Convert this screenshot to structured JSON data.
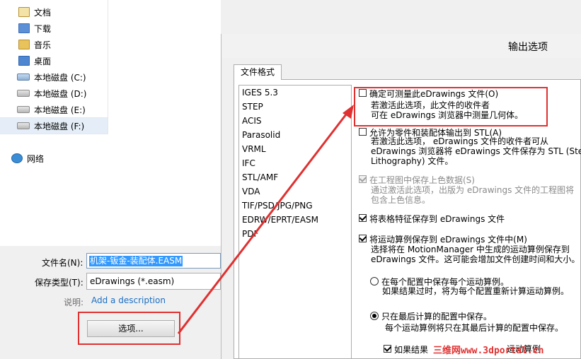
{
  "nav": {
    "items": [
      {
        "label": "文档",
        "icon": "document-folder-icon"
      },
      {
        "label": "下载",
        "icon": "download-folder-icon"
      },
      {
        "label": "音乐",
        "icon": "music-folder-icon"
      },
      {
        "label": "桌面",
        "icon": "desktop-folder-icon"
      },
      {
        "label": "本地磁盘 (C:)",
        "icon": "windows-drive-icon"
      },
      {
        "label": "本地磁盘 (D:)",
        "icon": "drive-icon"
      },
      {
        "label": "本地磁盘 (E:)",
        "icon": "drive-icon"
      },
      {
        "label": "本地磁盘 (F:)",
        "icon": "drive-icon"
      },
      {
        "label": "网络",
        "icon": "network-icon"
      }
    ]
  },
  "save": {
    "filename_label": "文件名(N):",
    "filename_value": "机架-钣金-装配体.EASM",
    "filetype_label": "保存类型(T):",
    "filetype_value": "eDrawings (*.easm)",
    "desc_label": "说明:",
    "desc_link": "Add a description",
    "options_button": "选项..."
  },
  "options_dialog": {
    "title": "输出选项",
    "tab": "文件格式",
    "formats": [
      "IGES 5.3",
      "STEP",
      "ACIS",
      "Parasolid",
      "VRML",
      "IFC",
      "STL/AMF",
      "VDA",
      "TIF/PSD/JPG/PNG",
      "EDRW/EPRT/EASM",
      "PDF"
    ],
    "options": {
      "measurable_label": "确定可测量此eDrawings 文件(O)",
      "measurable_desc1": "若激活此选项，此文件的收件者",
      "measurable_desc2": "可在 eDrawings 浏览器中测量几何体。",
      "stl_label": "允许为零件和装配体输出到 STL(A)",
      "stl_desc1": "若激活此选项， eDrawings 文件的收件者可从",
      "stl_desc2": "eDrawings 浏览器将  eDrawings 文件保存为 STL (Stereo",
      "stl_desc3": "Lithography) 文件。",
      "shade_label": "在工程图中保存上色数据(S)",
      "shade_desc1": "通过激活此选项，出版为  eDrawings 文件的工程图将",
      "shade_desc2": "包含上色信息。",
      "table_label": "将表格特征保存到 eDrawings 文件",
      "motion_label": "将运动算例保存到  eDrawings 文件中(M)",
      "motion_desc1": "选择将在 MotionManager 中生成的运动算例保存到",
      "motion_desc2": "eDrawings 文件。这可能会增加文件创建时间和大小。",
      "radio_each_label": "在每个配置中保存每个运动算例。",
      "radio_each_desc": "如果结果过时，将为每个配置重新计算运动算例。",
      "radio_last_label": "只在最后计算的配置中保存。",
      "radio_last_desc": "每个运动算例将只在其最后计算的配置中保存。",
      "partial_label": "如果结果",
      "partial_label2": "运动算例"
    }
  },
  "watermark": "三维网www.3dportal.cn",
  "colors": {
    "highlight_red": "#e03030",
    "selection_blue": "#3399ff",
    "link_blue": "#1a6fc4"
  }
}
